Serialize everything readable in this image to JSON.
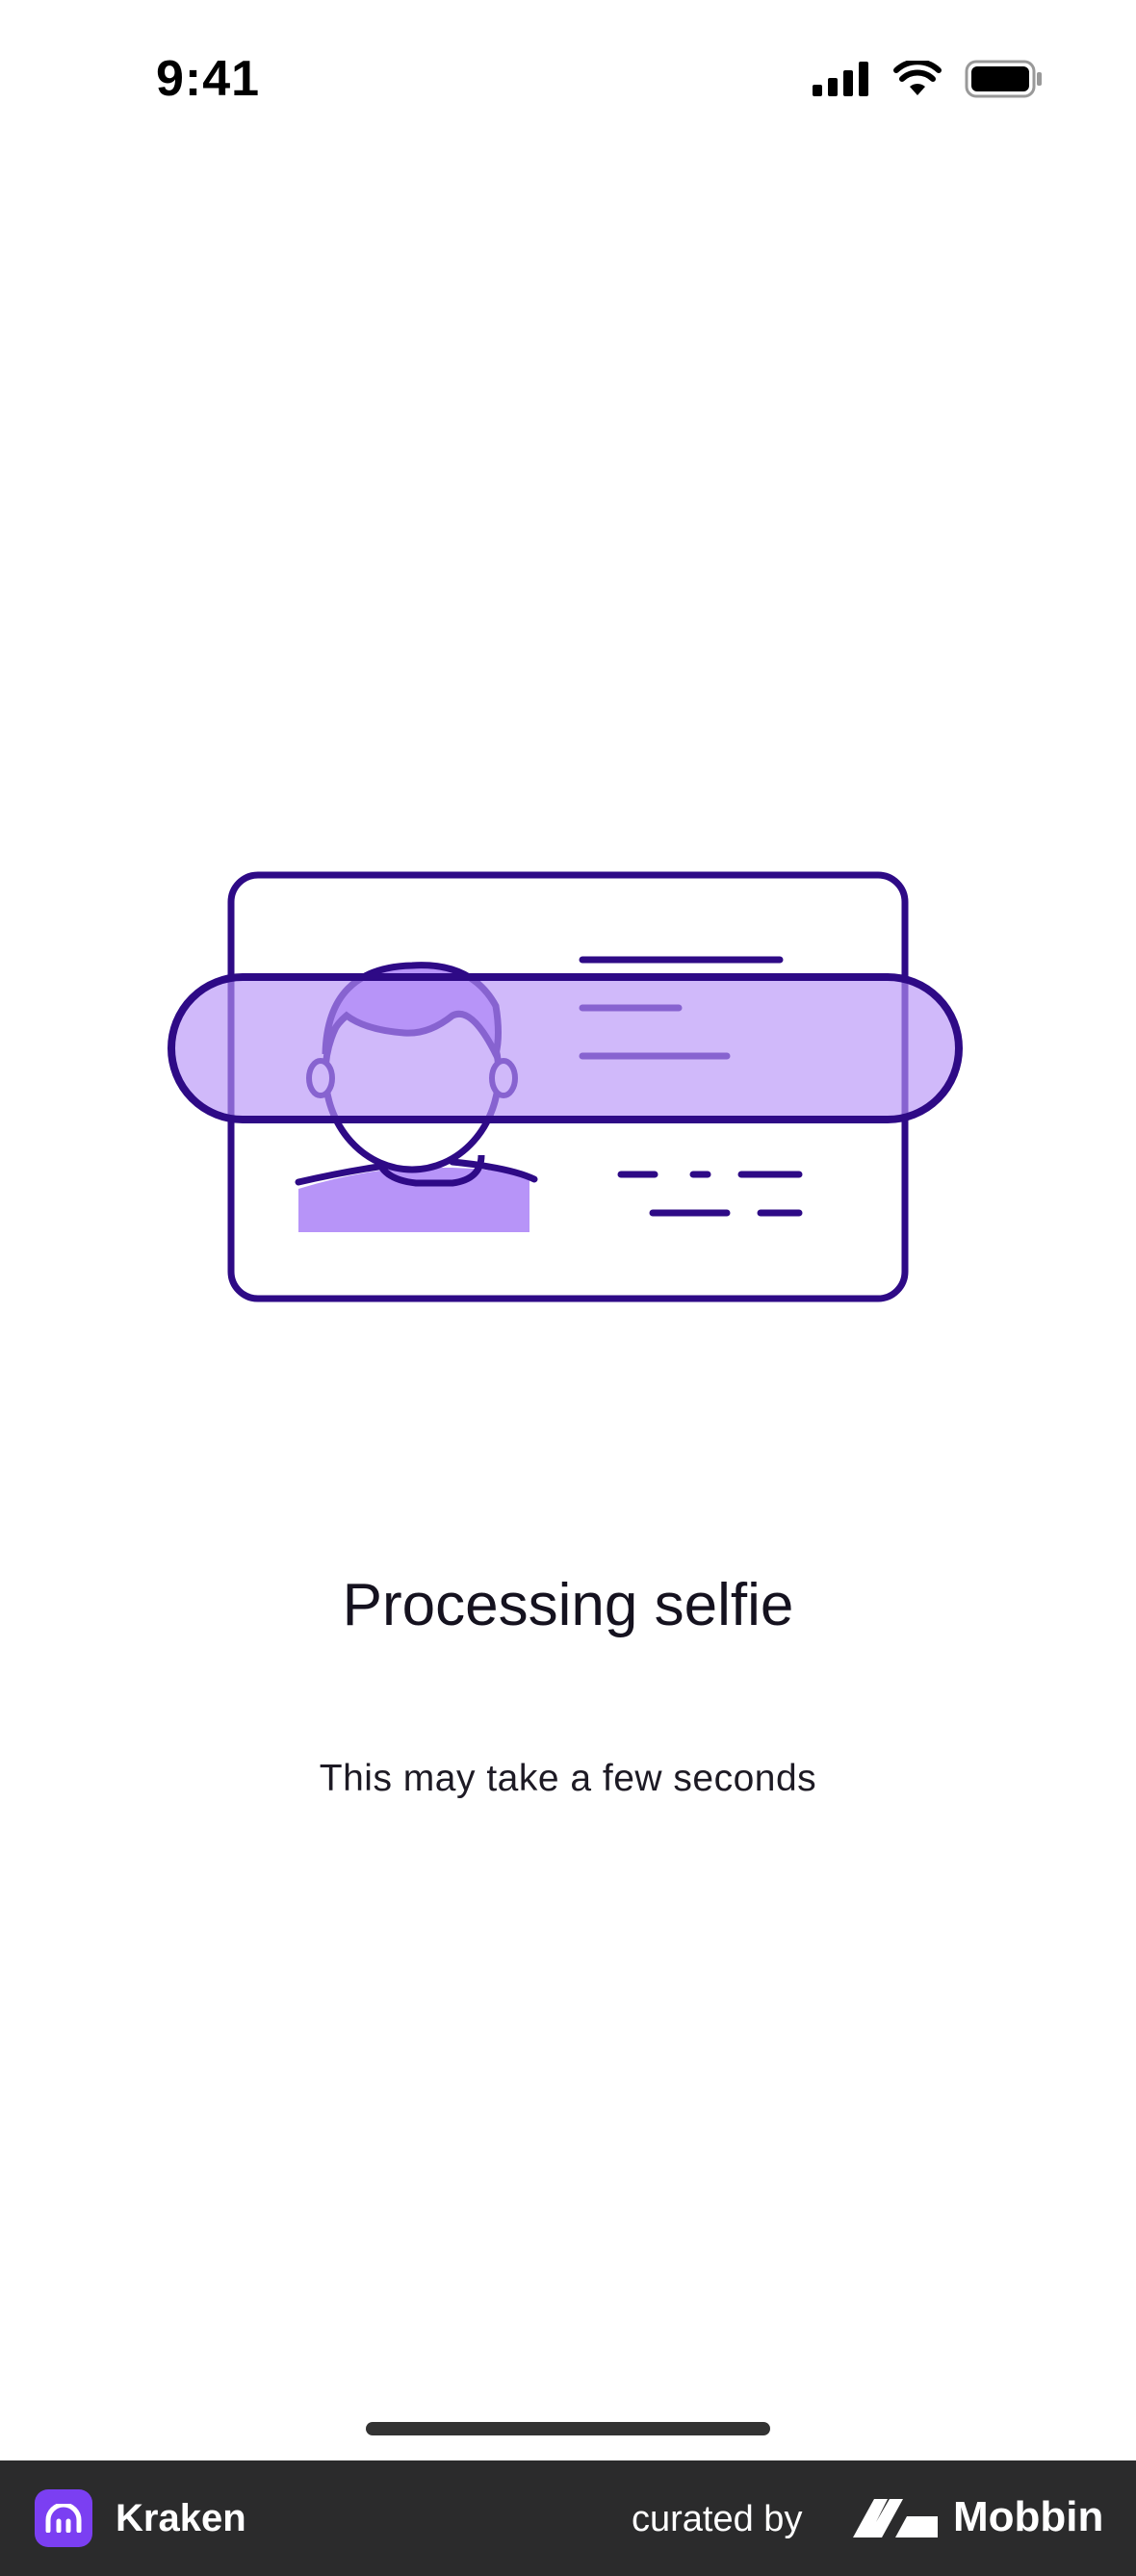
{
  "status_bar": {
    "time": "9:41",
    "icons": [
      "cellular-signal-icon",
      "wifi-icon",
      "battery-icon"
    ]
  },
  "illustration": {
    "icon": "id-card-scan-icon",
    "colors": {
      "stroke": "#2e0a86",
      "fill": "#b794f8",
      "band": "#c9a8fc"
    }
  },
  "main": {
    "title": "Processing selfie",
    "subtitle": "This may take a few seconds"
  },
  "footer": {
    "app_name": "Kraken",
    "app_icon": "kraken-logo-icon",
    "curated_by": "curated by",
    "brand_name": "Mobbin",
    "brand_icon": "mobbin-logo-icon",
    "colors": {
      "background": "#2b2b2c",
      "app_icon": "#7b3ff2"
    }
  }
}
